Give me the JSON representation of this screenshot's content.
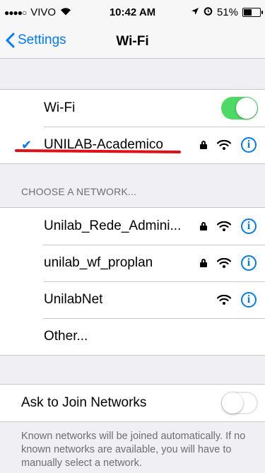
{
  "status_bar": {
    "signal_dots": "●●●●○",
    "carrier": "VIVO",
    "time": "10:42 AM",
    "battery_percent": "51%"
  },
  "nav": {
    "back_label": "Settings",
    "title": "Wi-Fi"
  },
  "wifi_toggle": {
    "label": "Wi-Fi",
    "state": "on"
  },
  "connected_network": {
    "name": "UNILAB-Academico",
    "secured": true
  },
  "section_header": "CHOOSE A NETWORK...",
  "networks": [
    {
      "name": "Unilab_Rede_Admini...",
      "secured": true
    },
    {
      "name": "unilab_wf_proplan",
      "secured": true
    },
    {
      "name": "UnilabNet",
      "secured": false
    }
  ],
  "other_label": "Other...",
  "ask_to_join": {
    "label": "Ask to Join Networks",
    "state": "off"
  },
  "footer": "Known networks will be joined automatically. If no known networks are available, you will have to manually select a network.",
  "colors": {
    "accent": "#007aff",
    "toggle_on": "#4cd964",
    "annotation_red": "#e0101a",
    "background": "#efeff4"
  }
}
